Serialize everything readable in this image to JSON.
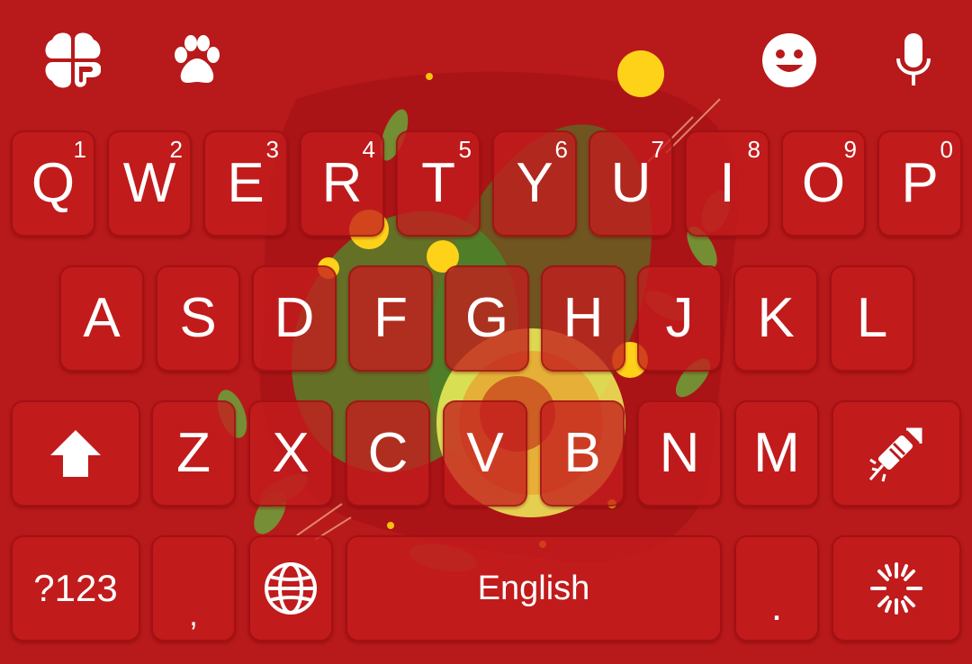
{
  "keyboard": {
    "toolbar": {
      "left_icons": [
        "clover-launcher-icon",
        "paw-icon"
      ],
      "right_icons": [
        "emoji-icon",
        "microphone-icon"
      ]
    },
    "row1": [
      {
        "label": "Q",
        "hint": "1"
      },
      {
        "label": "W",
        "hint": "2"
      },
      {
        "label": "E",
        "hint": "3"
      },
      {
        "label": "R",
        "hint": "4"
      },
      {
        "label": "T",
        "hint": "5"
      },
      {
        "label": "Y",
        "hint": "6"
      },
      {
        "label": "U",
        "hint": "7"
      },
      {
        "label": "I",
        "hint": "8"
      },
      {
        "label": "O",
        "hint": "9"
      },
      {
        "label": "P",
        "hint": "0"
      }
    ],
    "row2": [
      "A",
      "S",
      "D",
      "F",
      "G",
      "H",
      "J",
      "K",
      "L"
    ],
    "row3": [
      "Z",
      "X",
      "C",
      "V",
      "B",
      "N",
      "M"
    ],
    "row3_icons": {
      "left": "shift-arrow-icon",
      "right": "firework-rocket-icon"
    },
    "row4": {
      "symbols_label": "?123",
      "comma_label": ",",
      "globe_icon": "globe-icon",
      "space_label": "English",
      "period_label": ".",
      "effect_icon": "sparkle-burst-icon"
    },
    "colors": {
      "background": "#b8191a",
      "key": "#c41c1e",
      "text": "#ffffff"
    }
  }
}
